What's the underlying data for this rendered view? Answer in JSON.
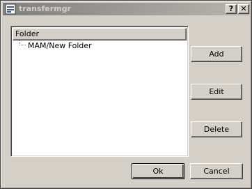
{
  "window": {
    "title": "transfermgr",
    "help_label": "?",
    "close_label": "✕"
  },
  "tree": {
    "column_header": "Folder",
    "items": [
      {
        "label": "MAM/New Folder"
      }
    ]
  },
  "buttons": {
    "add": "Add",
    "edit": "Edit",
    "delete": "Delete",
    "ok": "Ok",
    "cancel": "Cancel"
  },
  "colors": {
    "dialog_face": "#d4d0c8",
    "titlebar_start": "#808080",
    "titlebar_end": "#b8b4ae",
    "title_text": "#d4d0c8",
    "list_background": "#ffffff"
  }
}
